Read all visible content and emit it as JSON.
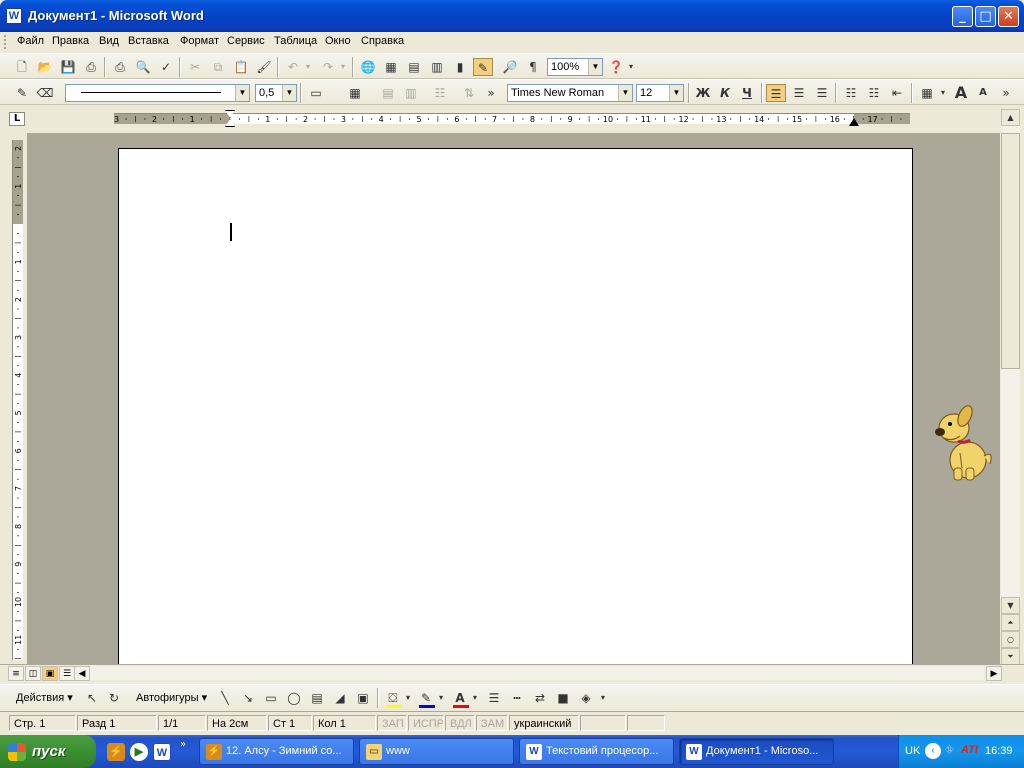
{
  "window": {
    "title": "Документ1 - Microsoft Word",
    "app_icon": "W",
    "minimize_icon": "minimize-icon",
    "maximize_icon": "maximize-icon",
    "close_icon": "close-icon"
  },
  "menubar": {
    "items": [
      "Файл",
      "Правка",
      "Вид",
      "Вставка",
      "Формат",
      "Сервис",
      "Таблица",
      "Окно",
      "Справка"
    ]
  },
  "standard_toolbar": {
    "zoom": "100%",
    "help_icon": "help-icon",
    "pilcrow": "¶"
  },
  "format_toolbar": {
    "line_weight": "0,5",
    "font_name": "Times New Roman",
    "font_size": "12",
    "bold": "Ж",
    "italic": "К",
    "underline": "Ч",
    "grow_font": "A",
    "shrink_font": "A"
  },
  "rulers": {
    "tab_selector": "L",
    "h_numbers": [
      "3",
      "2",
      "1",
      "1",
      "2",
      "3",
      "4",
      "5",
      "6",
      "7",
      "8",
      "9",
      "10",
      "11",
      "12",
      "13",
      "14",
      "15",
      "16",
      "17"
    ],
    "v_numbers": [
      "2",
      "1",
      "1",
      "2",
      "3",
      "4",
      "5",
      "6",
      "7",
      "8",
      "9",
      "10",
      "11"
    ]
  },
  "drawing_toolbar": {
    "actions": "Действия ▾",
    "autoshapes": "Автофигуры ▾",
    "font_color_letter": "A"
  },
  "statusbar": {
    "page": "Стр. 1",
    "section": "Разд 1",
    "pages": "1/1",
    "at": "На 2см",
    "line": "Ст 1",
    "col": "Кол 1",
    "rec": "ЗАП",
    "trk": "ИСПР",
    "ext": "ВДЛ",
    "ovr": "ЗАМ",
    "language": "украинский"
  },
  "taskbar": {
    "start": "пуск",
    "tasks": [
      {
        "label": "12. Алсу - Зимний со...",
        "icon": "winamp-icon"
      },
      {
        "label": "www",
        "icon": "folder-icon"
      },
      {
        "label": "Текстовий процесор...",
        "icon": "word-icon"
      },
      {
        "label": "Документ1 - Microso...",
        "icon": "word-icon"
      }
    ],
    "tray": {
      "lang": "UK",
      "time": "16:39"
    }
  },
  "colors": {
    "titlebar_blue": "#0343c7",
    "start_green": "#3b8f32",
    "taskbar_blue": "#245ad8",
    "tray_blue": "#1597eb",
    "highlight_yellow": "#ffff00",
    "line_blue": "#0000ff",
    "font_red": "#ff0000"
  }
}
